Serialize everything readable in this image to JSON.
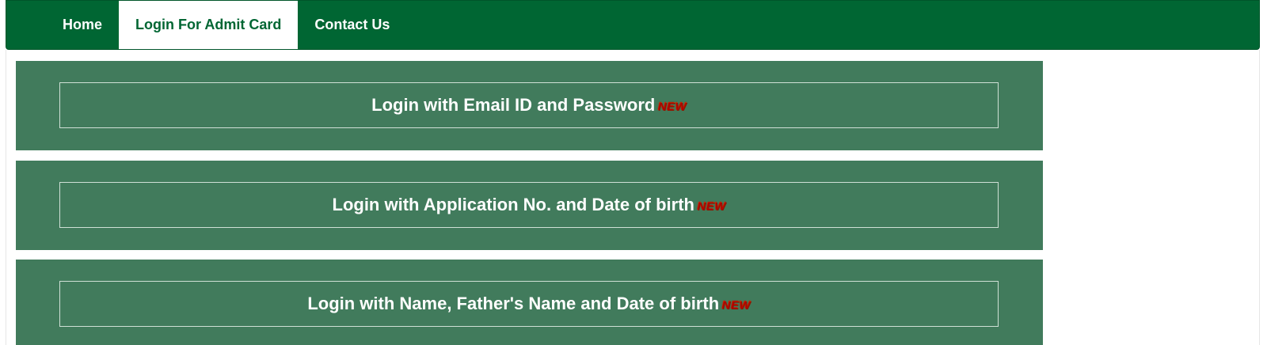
{
  "nav": {
    "items": [
      {
        "label": "Home",
        "active": false
      },
      {
        "label": "Login For Admit Card",
        "active": true
      },
      {
        "label": "Contact Us",
        "active": false
      }
    ]
  },
  "login_options": [
    {
      "label": "Login with Email ID and Password",
      "badge": "NEW"
    },
    {
      "label": "Login with Application No. and Date of birth",
      "badge": "NEW"
    },
    {
      "label": "Login with Name, Father's Name and Date of birth",
      "badge": "NEW"
    }
  ],
  "colors": {
    "nav_bg": "#006633",
    "panel_bg": "#417b5c",
    "badge": "#ff5a00"
  }
}
